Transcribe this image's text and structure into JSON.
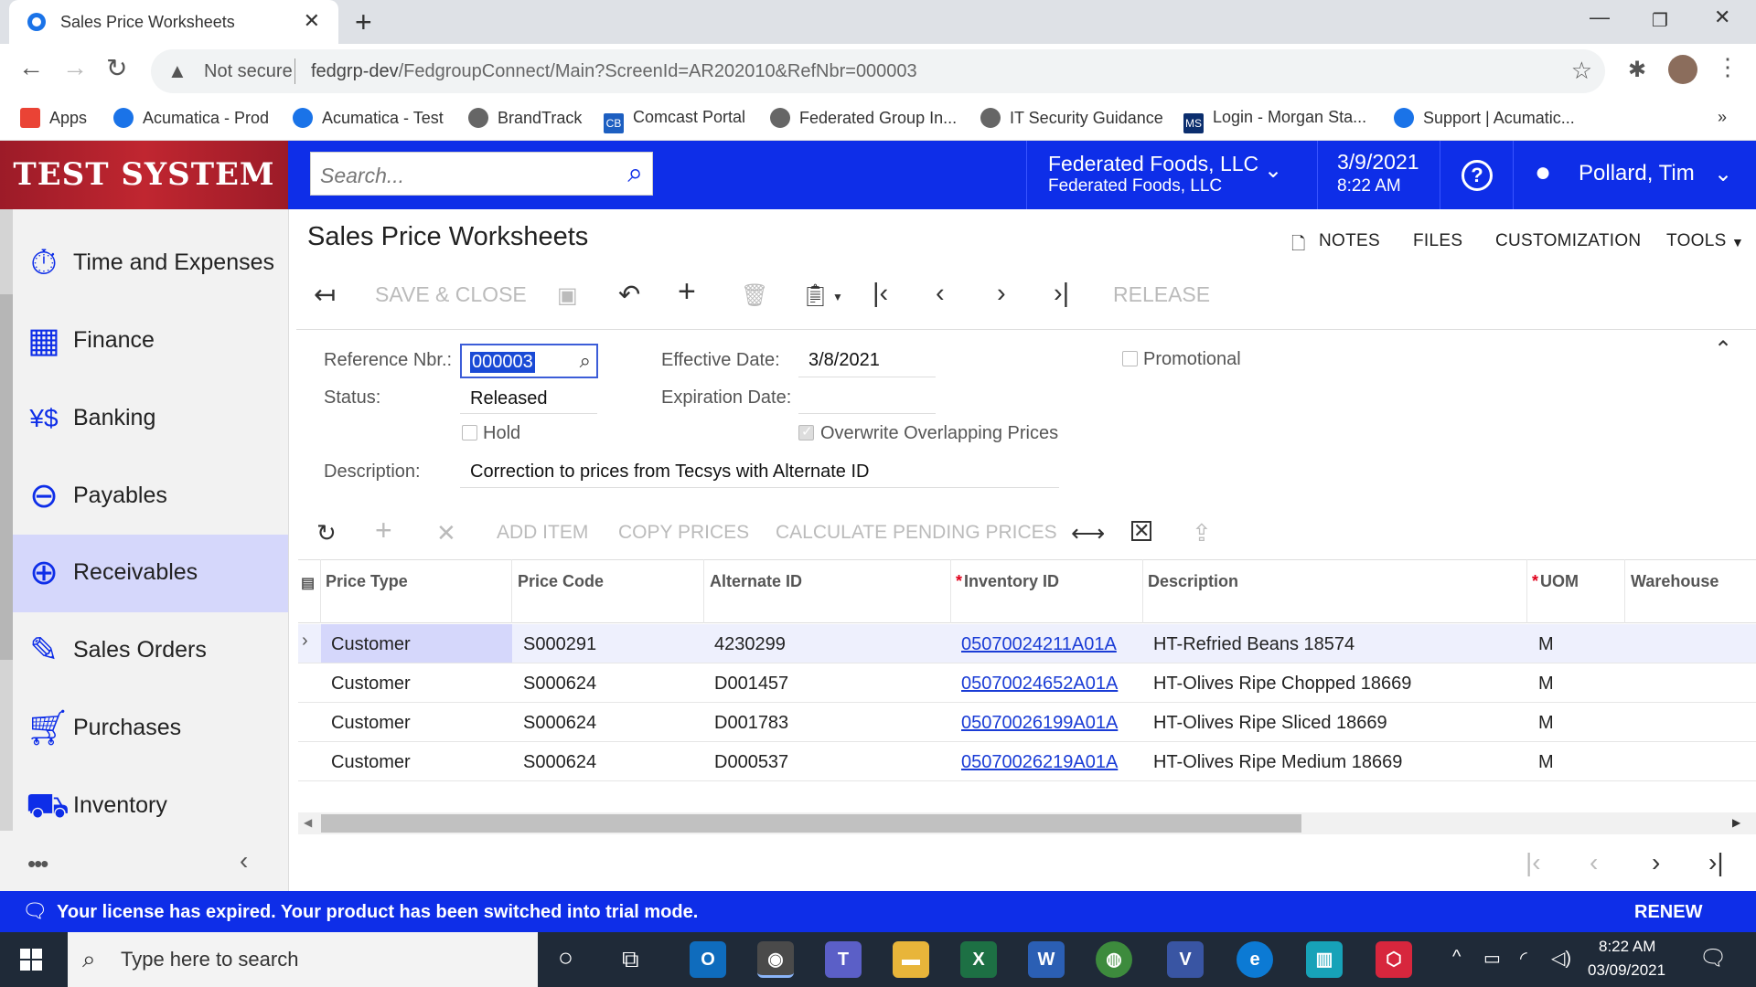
{
  "browser": {
    "tab_title": "Sales Price Worksheets",
    "not_secure": "Not secure",
    "url_host": "fedgrp-dev",
    "url_path": "/FedgroupConnect/Main?ScreenId=AR202010&RefNbr=000003",
    "bookmarks": [
      "Apps",
      "Acumatica - Prod",
      "Acumatica - Test",
      "BrandTrack",
      "Comcast Portal",
      "Federated Group In...",
      "IT Security Guidance",
      "Login - Morgan Sta...",
      "Support | Acumatic..."
    ],
    "bookmark_more": "»"
  },
  "header": {
    "logo_text": "TEST SYSTEM",
    "search_placeholder": "Search...",
    "company_line1": "Federated Foods, LLC",
    "company_line2": "Federated Foods, LLC",
    "date": "3/9/2021",
    "time": "8:22 AM",
    "user": "Pollard, Tim"
  },
  "sidebar": {
    "items": [
      {
        "label": "Time and Expenses",
        "icon": "stopwatch-icon"
      },
      {
        "label": "Finance",
        "icon": "calculator-icon"
      },
      {
        "label": "Banking",
        "icon": "currency-icon"
      },
      {
        "label": "Payables",
        "icon": "minus-circle-icon"
      },
      {
        "label": "Receivables",
        "icon": "plus-circle-icon"
      },
      {
        "label": "Sales Orders",
        "icon": "edit-icon"
      },
      {
        "label": "Purchases",
        "icon": "cart-icon"
      },
      {
        "label": "Inventory",
        "icon": "truck-icon"
      }
    ],
    "active": "Receivables",
    "more": "•••"
  },
  "page": {
    "title": "Sales Price Worksheets",
    "top_links": {
      "notes": "NOTES",
      "files": "FILES",
      "customization": "CUSTOMIZATION",
      "tools": "TOOLS"
    },
    "toolbar": {
      "save_close": "SAVE & CLOSE",
      "release": "RELEASE"
    }
  },
  "form": {
    "ref_label": "Reference Nbr.:",
    "ref_value": "000003",
    "status_label": "Status:",
    "status_value": "Released",
    "hold_label": "Hold",
    "hold_checked": false,
    "description_label": "Description:",
    "description_value": "Correction to prices from Tecsys with Alternate ID",
    "effective_label": "Effective Date:",
    "effective_value": "3/8/2021",
    "expiration_label": "Expiration Date:",
    "expiration_value": "",
    "overwrite_label": "Overwrite Overlapping Prices",
    "overwrite_checked": true,
    "promotional_label": "Promotional",
    "promotional_checked": false
  },
  "grid_toolbar": {
    "add_item": "ADD ITEM",
    "copy_prices": "COPY PRICES",
    "calc_pending": "CALCULATE PENDING PRICES"
  },
  "grid": {
    "columns": [
      "Price Type",
      "Price Code",
      "Alternate ID",
      "Inventory ID",
      "Description",
      "UOM",
      "Warehouse"
    ],
    "required_columns": [
      "Inventory ID",
      "UOM"
    ],
    "rows": [
      {
        "price_type": "Customer",
        "price_code": "S000291",
        "alternate_id": "4230299",
        "inventory_id": "05070024211A01A",
        "description": "HT-Refried Beans 18574",
        "uom": "M",
        "warehouse": ""
      },
      {
        "price_type": "Customer",
        "price_code": "S000624",
        "alternate_id": "D001457",
        "inventory_id": "05070024652A01A",
        "description": "HT-Olives Ripe Chopped 18669",
        "uom": "M",
        "warehouse": ""
      },
      {
        "price_type": "Customer",
        "price_code": "S000624",
        "alternate_id": "D001783",
        "inventory_id": "05070026199A01A",
        "description": "HT-Olives Ripe Sliced 18669",
        "uom": "M",
        "warehouse": ""
      },
      {
        "price_type": "Customer",
        "price_code": "S000624",
        "alternate_id": "D000537",
        "inventory_id": "05070026219A01A",
        "description": "HT-Olives Ripe Medium 18669",
        "uom": "M",
        "warehouse": ""
      }
    ]
  },
  "license": {
    "message": "Your license has expired. Your product has been switched into trial mode.",
    "renew": "RENEW"
  },
  "taskbar": {
    "search_placeholder": "Type here to search",
    "time": "8:22 AM",
    "date": "03/09/2021"
  },
  "colors": {
    "brand_blue": "#0e2ee8",
    "active_item": "#d5d7fb",
    "link": "#1a3cd6",
    "required": "#e0001b"
  }
}
